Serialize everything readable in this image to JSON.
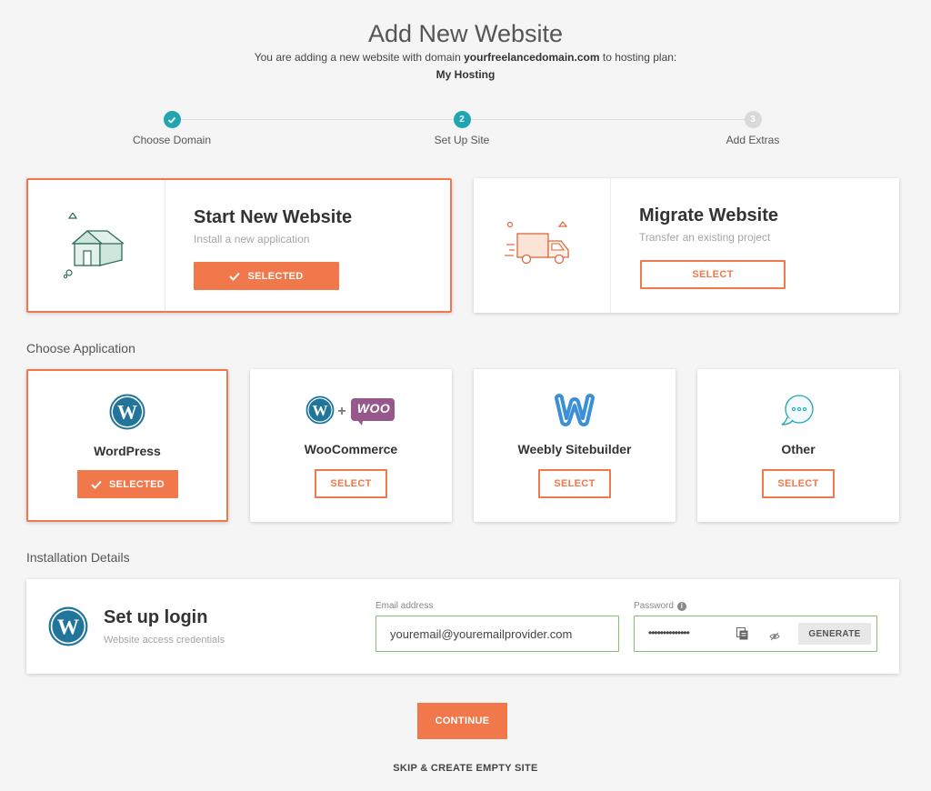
{
  "header": {
    "title": "Add New Website",
    "subtitle_prefix": "You are adding a new website with domain",
    "domain": "yourfreelancedomain.com",
    "subtitle_suffix": "to hosting plan:",
    "plan": "My Hosting"
  },
  "stepper": {
    "steps": [
      {
        "label": "Choose Domain",
        "state": "done",
        "marker": "✓"
      },
      {
        "label": "Set Up Site",
        "state": "active",
        "marker": "2"
      },
      {
        "label": "Add Extras",
        "state": "todo",
        "marker": "3"
      }
    ]
  },
  "site_type": {
    "start": {
      "title": "Start New Website",
      "desc": "Install a new application",
      "button": "SELECTED",
      "icon": "house-icon"
    },
    "migrate": {
      "title": "Migrate Website",
      "desc": "Transfer an existing project",
      "button": "SELECT",
      "icon": "truck-icon"
    }
  },
  "applications": {
    "label": "Choose Application",
    "items": [
      {
        "name": "WordPress",
        "button": "SELECTED",
        "selected": true,
        "icon": "wordpress-icon"
      },
      {
        "name": "WooCommerce",
        "button": "SELECT",
        "selected": false,
        "icon": "woocommerce-icon",
        "badge": "WOO"
      },
      {
        "name": "Weebly Sitebuilder",
        "button": "SELECT",
        "selected": false,
        "icon": "weebly-icon"
      },
      {
        "name": "Other",
        "button": "SELECT",
        "selected": false,
        "icon": "chat-bubble-icon"
      }
    ]
  },
  "installation": {
    "label": "Installation Details",
    "title": "Set up login",
    "desc": "Website access credentials",
    "email_label": "Email address",
    "email_value": "youremail@youremailprovider.com",
    "password_label": "Password",
    "password_value": "••••••••••••••",
    "generate": "GENERATE"
  },
  "actions": {
    "continue": "CONTINUE",
    "skip": "SKIP & CREATE EMPTY SITE"
  },
  "colors": {
    "accent": "#f0784a",
    "step": "#22a5b3",
    "wp_blue": "#21759b",
    "field_border": "#82c26a"
  }
}
